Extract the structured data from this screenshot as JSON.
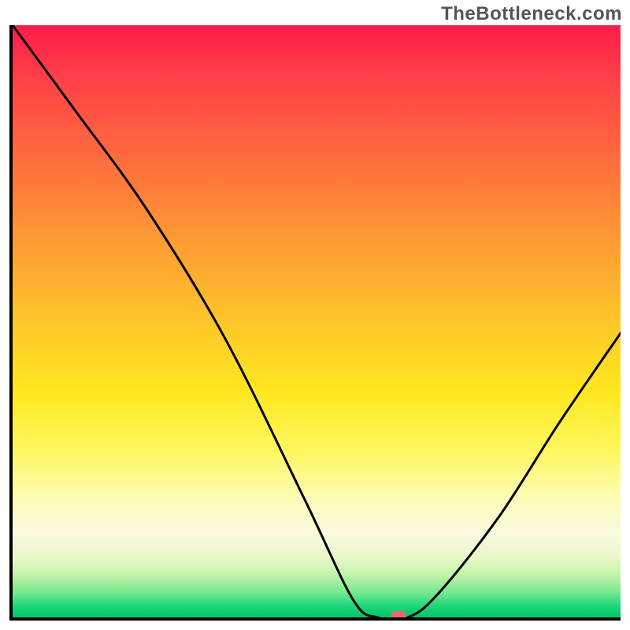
{
  "attribution": "TheBottleneck.com",
  "chart_data": {
    "type": "line",
    "title": "",
    "xlabel": "",
    "ylabel": "",
    "x_range": [
      0,
      100
    ],
    "y_range": [
      0,
      100
    ],
    "series": [
      {
        "name": "bottleneck-curve",
        "points": [
          {
            "x": 0,
            "y": 100
          },
          {
            "x": 10,
            "y": 86
          },
          {
            "x": 22,
            "y": 69
          },
          {
            "x": 35,
            "y": 47
          },
          {
            "x": 48,
            "y": 20
          },
          {
            "x": 56,
            "y": 3
          },
          {
            "x": 60,
            "y": 0
          },
          {
            "x": 65,
            "y": 0
          },
          {
            "x": 70,
            "y": 4
          },
          {
            "x": 80,
            "y": 17
          },
          {
            "x": 90,
            "y": 33
          },
          {
            "x": 100,
            "y": 48
          }
        ]
      }
    ],
    "optimal_marker": {
      "x": 63.5,
      "y": 0
    },
    "background_gradient": {
      "stops": [
        {
          "pct": 0,
          "color": "#ff1b4a"
        },
        {
          "pct": 50,
          "color": "#ffc529"
        },
        {
          "pct": 80,
          "color": "#fdfcb8"
        },
        {
          "pct": 100,
          "color": "#00c46a"
        }
      ]
    }
  }
}
